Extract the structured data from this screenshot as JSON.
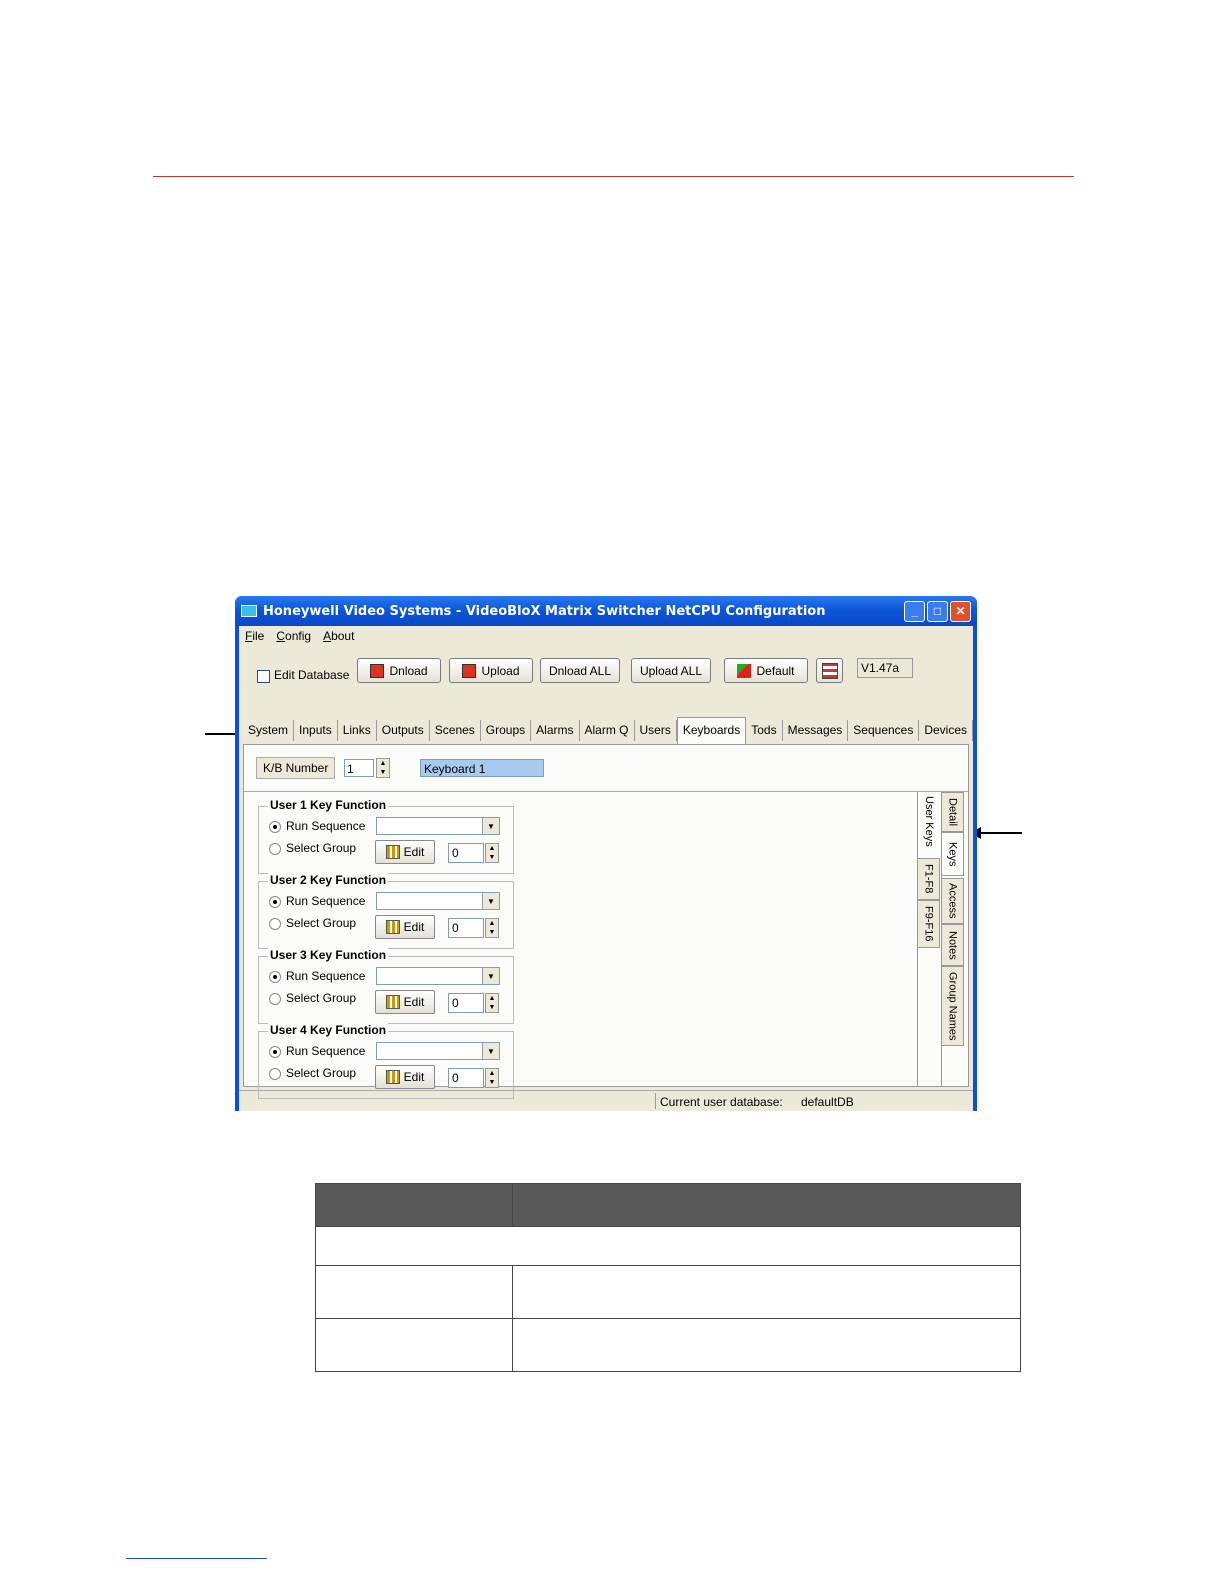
{
  "window": {
    "title": "Honeywell Video Systems - VideoBloX Matrix Switcher NetCPU Configuration",
    "controls": {
      "minimize": "_",
      "maximize": "□",
      "close": "✕"
    }
  },
  "menu": [
    "File",
    "Config",
    "About"
  ],
  "toolbar": {
    "edit_db_label": "Edit Database",
    "dload": "Dnload",
    "upload": "Upload",
    "dload_all": "Dnload ALL",
    "upload_all": "Upload ALL",
    "default": "Default",
    "version": "V1.47a"
  },
  "tabs": [
    "System",
    "Inputs",
    "Links",
    "Outputs",
    "Scenes",
    "Groups",
    "Alarms",
    "Alarm Q",
    "Users",
    "Keyboards",
    "Tods",
    "Messages",
    "Sequences",
    "Devices"
  ],
  "active_tab": "Keyboards",
  "kb": {
    "label": "K/B Number",
    "number": "1",
    "name": "Keyboard 1"
  },
  "user_keys": [
    {
      "title": "User 1 Key Function",
      "run": "Run Sequence",
      "select": "Select Group",
      "edit": "Edit",
      "value": "0"
    },
    {
      "title": "User 2 Key Function",
      "run": "Run Sequence",
      "select": "Select Group",
      "edit": "Edit",
      "value": "0"
    },
    {
      "title": "User 3 Key Function",
      "run": "Run Sequence",
      "select": "Select Group",
      "edit": "Edit",
      "value": "0"
    },
    {
      "title": "User 4 Key Function",
      "run": "Run Sequence",
      "select": "Select Group",
      "edit": "Edit",
      "value": "0"
    }
  ],
  "inner_vtabs": [
    "User Keys",
    "F1-F8",
    "F9-F16"
  ],
  "outer_vtabs": [
    "Detail",
    "Keys",
    "Access",
    "Notes",
    "Group Names"
  ],
  "status": {
    "label": "Current user database:",
    "value": "defaultDB"
  },
  "colors": {
    "accent_line": "#c0392b",
    "table_header": "#595959",
    "titlebar": "#0a50d8"
  }
}
